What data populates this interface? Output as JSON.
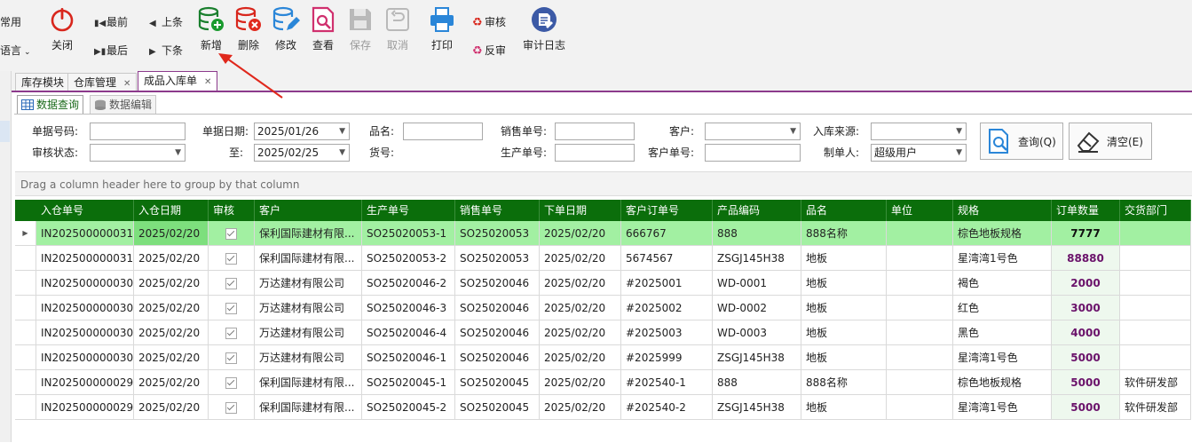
{
  "toolbar": {
    "left_items": [
      "常用",
      "语言"
    ],
    "close_label": "关闭",
    "nav": {
      "first": "最前",
      "prev": "上条",
      "last": "最后",
      "next": "下条"
    },
    "add_label": "新增",
    "delete_label": "删除",
    "edit_label": "修改",
    "view_label": "查看",
    "save_label": "保存",
    "cancel_label": "取消",
    "print_label": "打印",
    "audit_label": "审核",
    "unaudit_label": "反审",
    "audit_log_label": "审计日志"
  },
  "tabs": [
    {
      "label": "库存模块"
    },
    {
      "label": "仓库管理"
    },
    {
      "label": "成品入库单"
    }
  ],
  "subtabs": [
    {
      "label": "数据查询"
    },
    {
      "label": "数据编辑"
    }
  ],
  "filters": {
    "doc_no_label": "单据号码:",
    "doc_date_label": "单据日期:",
    "doc_date_from": "2025/01/26",
    "to_label": "至:",
    "doc_date_to": "2025/02/25",
    "product_name_label": "品名:",
    "goods_no_label": "货号:",
    "sales_no_label": "销售单号:",
    "production_no_label": "生产单号:",
    "customer_label": "客户:",
    "customer_order_label": "客户单号:",
    "source_label": "入库来源:",
    "creator_label": "制单人:",
    "creator_value": "超级用户",
    "audit_status_label": "审核状态:",
    "query_button": "查询(Q)",
    "clear_button": "清空(E)"
  },
  "group_hint": "Drag a column header here to group by that column",
  "columns": [
    "入仓单号",
    "入仓日期",
    "审核",
    "客户",
    "生产单号",
    "销售单号",
    "下单日期",
    "客户订单号",
    "产品编码",
    "品名",
    "单位",
    "规格",
    "订单数量",
    "交货部门"
  ],
  "rows": [
    [
      "IN202500000031",
      "2025/02/20",
      true,
      "保利国际建材有限...",
      "SO25020053-1",
      "SO25020053",
      "2025/02/20",
      "666767",
      "888",
      "888名称",
      "",
      "棕色地板规格",
      "7777",
      ""
    ],
    [
      "IN202500000031",
      "2025/02/20",
      true,
      "保利国际建材有限...",
      "SO25020053-2",
      "SO25020053",
      "2025/02/20",
      "5674567",
      "ZSGJ145H38",
      "地板",
      "",
      "星湾湾1号色",
      "88880",
      ""
    ],
    [
      "IN202500000030",
      "2025/02/20",
      true,
      "万达建材有限公司",
      "SO25020046-2",
      "SO25020046",
      "2025/02/20",
      "#2025001",
      "WD-0001",
      "地板",
      "",
      "褐色",
      "2000",
      ""
    ],
    [
      "IN202500000030",
      "2025/02/20",
      true,
      "万达建材有限公司",
      "SO25020046-3",
      "SO25020046",
      "2025/02/20",
      "#2025002",
      "WD-0002",
      "地板",
      "",
      "红色",
      "3000",
      ""
    ],
    [
      "IN202500000030",
      "2025/02/20",
      true,
      "万达建材有限公司",
      "SO25020046-4",
      "SO25020046",
      "2025/02/20",
      "#2025003",
      "WD-0003",
      "地板",
      "",
      "黑色",
      "4000",
      ""
    ],
    [
      "IN202500000030",
      "2025/02/20",
      true,
      "万达建材有限公司",
      "SO25020046-1",
      "SO25020046",
      "2025/02/20",
      "#2025999",
      "ZSGJ145H38",
      "地板",
      "",
      "星湾湾1号色",
      "5000",
      ""
    ],
    [
      "IN202500000029",
      "2025/02/20",
      true,
      "保利国际建材有限...",
      "SO25020045-1",
      "SO25020045",
      "2025/02/20",
      "#202540-1",
      "888",
      "888名称",
      "",
      "棕色地板规格",
      "5000",
      "软件研发部"
    ],
    [
      "IN202500000029",
      "2025/02/20",
      true,
      "保利国际建材有限...",
      "SO25020045-2",
      "SO25020045",
      "2025/02/20",
      "#202540-2",
      "ZSGJ145H38",
      "地板",
      "",
      "星湾湾1号色",
      "5000",
      "软件研发部"
    ]
  ],
  "colors": {
    "header_bg": "#0b6e0b",
    "selected_row": "#a2f0a2",
    "quantity_text": "#6a126a",
    "tab_accent": "#8c3a8c"
  }
}
